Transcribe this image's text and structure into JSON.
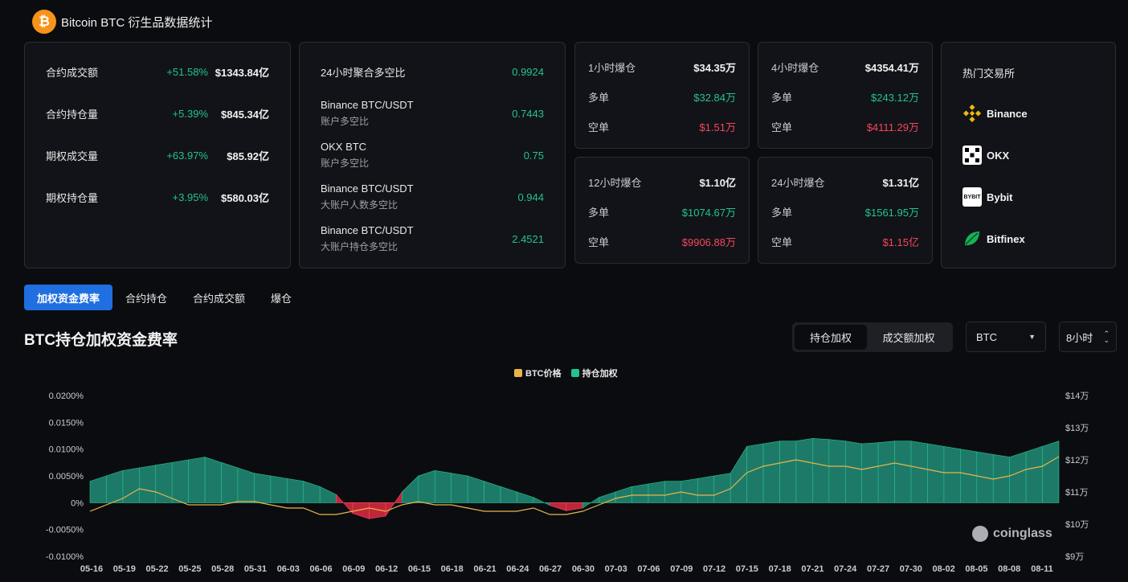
{
  "header": {
    "title": "Bitcoin BTC 衍生品数据统计",
    "logo_glyph": "₿"
  },
  "metrics": [
    {
      "label": "合约成交额",
      "change": "+51.58%",
      "value": "$1343.84亿"
    },
    {
      "label": "合约持仓量",
      "change": "+5.39%",
      "value": "$845.34亿"
    },
    {
      "label": "期权成交量",
      "change": "+63.97%",
      "value": "$85.92亿"
    },
    {
      "label": "期权持仓量",
      "change": "+3.95%",
      "value": "$580.03亿"
    }
  ],
  "long_short": {
    "agg_label": "24小时聚合多空比",
    "agg_value": "0.9924",
    "items": [
      {
        "name": "Binance BTC/USDT",
        "sub": "账户多空比",
        "value": "0.7443"
      },
      {
        "name": "OKX BTC",
        "sub": "账户多空比",
        "value": "0.75"
      },
      {
        "name": "Binance BTC/USDT",
        "sub": "大账户人数多空比",
        "value": "0.944"
      },
      {
        "name": "Binance BTC/USDT",
        "sub": "大账户持仓多空比",
        "value": "2.4521"
      }
    ]
  },
  "liquidations": [
    {
      "title": "1小时爆仓",
      "total": "$34.35万",
      "long_label": "多单",
      "long": "$32.84万",
      "short_label": "空单",
      "short": "$1.51万"
    },
    {
      "title": "4小时爆仓",
      "total": "$4354.41万",
      "long_label": "多单",
      "long": "$243.12万",
      "short_label": "空单",
      "short": "$4111.29万"
    },
    {
      "title": "12小时爆仓",
      "total": "$1.10亿",
      "long_label": "多单",
      "long": "$1074.67万",
      "short_label": "空单",
      "short": "$9906.88万"
    },
    {
      "title": "24小时爆仓",
      "total": "$1.31亿",
      "long_label": "多单",
      "long": "$1561.95万",
      "short_label": "空单",
      "short": "$1.15亿"
    }
  ],
  "exchanges": {
    "title": "热门交易所",
    "items": [
      {
        "name": "Binance",
        "icon": "binance-icon"
      },
      {
        "name": "OKX",
        "icon": "okx-icon"
      },
      {
        "name": "Bybit",
        "icon": "bybit-icon",
        "glyph": "BYBIT"
      },
      {
        "name": "Bitfinex",
        "icon": "bitfinex-icon"
      }
    ]
  },
  "tabs": [
    "加权资金费率",
    "合约持仓",
    "合约成交额",
    "爆仓"
  ],
  "chart_title": "BTC持仓加权资金费率",
  "weight_toggle": {
    "options": [
      "持仓加权",
      "成交额加权"
    ],
    "selected": "持仓加权"
  },
  "coin_select": {
    "value": "BTC"
  },
  "interval_select": {
    "value": "8小时"
  },
  "watermark": "coinglass",
  "colors": {
    "accent": "#1f6fe0",
    "up": "#22c38e",
    "down": "#f6465d",
    "price_line": "#e7b549",
    "area": "#1e7a68"
  },
  "chart_data": {
    "type": "area",
    "legend": [
      "BTC价格",
      "持仓加权"
    ],
    "legend_placement": "top-center",
    "x_ticks": [
      "05-16",
      "05-19",
      "05-22",
      "05-25",
      "05-28",
      "05-31",
      "06-03",
      "06-06",
      "06-09",
      "06-12",
      "06-15",
      "06-18",
      "06-21",
      "06-24",
      "06-27",
      "06-30",
      "07-03",
      "07-06",
      "07-09",
      "07-12",
      "07-15",
      "07-18",
      "07-21",
      "07-24",
      "07-27",
      "07-30",
      "08-02",
      "08-05",
      "08-08",
      "08-11"
    ],
    "y_left_ticks": [
      "0.0200%",
      "0.0150%",
      "0.0100%",
      "0.0050%",
      "0%",
      "-0.0050%",
      "-0.0100%"
    ],
    "y_left_range": [
      -0.01,
      0.02
    ],
    "y_right_ticks": [
      "$14万",
      "$13万",
      "$12万",
      "$11万",
      "$10万",
      "$9万"
    ],
    "y_right_range": [
      9,
      14
    ],
    "series": [
      {
        "name": "持仓加权",
        "unit": "%",
        "values": [
          0.004,
          0.005,
          0.006,
          0.0065,
          0.007,
          0.0075,
          0.008,
          0.0085,
          0.0075,
          0.0065,
          0.0055,
          0.005,
          0.0045,
          0.004,
          0.003,
          0.0015,
          -0.002,
          -0.003,
          -0.0025,
          0.002,
          0.005,
          0.006,
          0.0055,
          0.005,
          0.004,
          0.003,
          0.002,
          0.001,
          -0.0005,
          -0.0015,
          -0.001,
          0.001,
          0.002,
          0.003,
          0.0035,
          0.004,
          0.004,
          0.0045,
          0.005,
          0.0055,
          0.0105,
          0.011,
          0.0115,
          0.0115,
          0.012,
          0.0118,
          0.0115,
          0.011,
          0.0112,
          0.0115,
          0.0115,
          0.011,
          0.0105,
          0.01,
          0.0095,
          0.009,
          0.0085,
          0.0095,
          0.0105,
          0.0115
        ]
      },
      {
        "name": "BTC价格",
        "unit": "万",
        "values": [
          10.4,
          10.6,
          10.8,
          11.1,
          11.0,
          10.8,
          10.6,
          10.6,
          10.6,
          10.7,
          10.7,
          10.6,
          10.5,
          10.5,
          10.3,
          10.3,
          10.4,
          10.5,
          10.4,
          10.6,
          10.7,
          10.6,
          10.6,
          10.5,
          10.4,
          10.4,
          10.4,
          10.5,
          10.3,
          10.3,
          10.4,
          10.6,
          10.8,
          10.9,
          10.9,
          10.9,
          11.0,
          10.9,
          10.9,
          11.1,
          11.6,
          11.8,
          11.9,
          12.0,
          11.9,
          11.8,
          11.8,
          11.7,
          11.8,
          11.9,
          11.8,
          11.7,
          11.6,
          11.6,
          11.5,
          11.4,
          11.5,
          11.7,
          11.8,
          12.1
        ]
      }
    ]
  }
}
